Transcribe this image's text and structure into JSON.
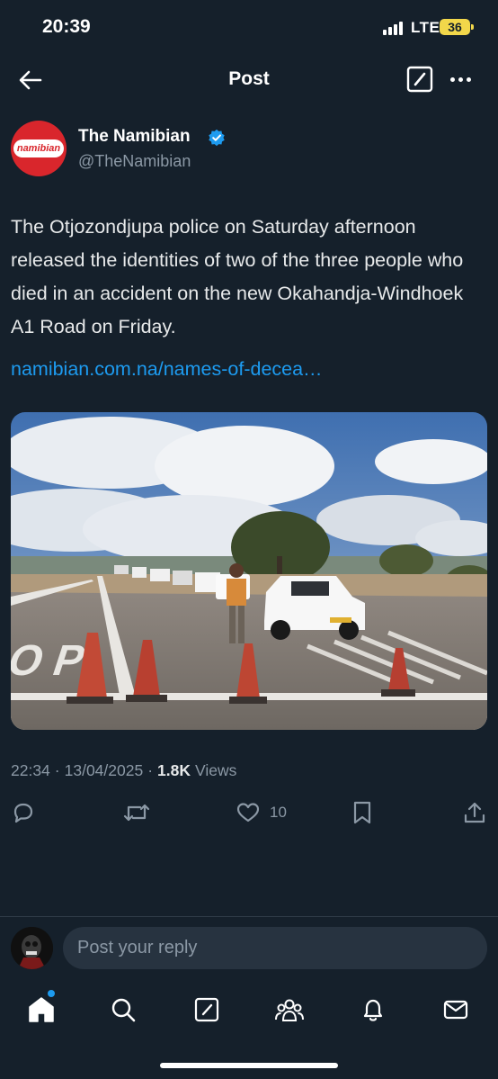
{
  "status_bar": {
    "time": "20:39",
    "network": "LTE",
    "battery": "36"
  },
  "header": {
    "title": "Post"
  },
  "author": {
    "name": "The Namibian",
    "handle": "@TheNamibian",
    "avatar_text": "namibian",
    "verified": true
  },
  "post": {
    "text": "The Otjozondjupa police on Saturday afternoon released the identities of two of the three people who died in an accident on the new Okahandja-Windhoek A1 Road on Friday.",
    "link": "namibian.com.na/names-of-decea…",
    "time": "22:34",
    "date": "13/04/2025",
    "views_count": "1.8K",
    "views_label": "Views"
  },
  "actions": {
    "likes": "10"
  },
  "reply": {
    "placeholder": "Post your reply"
  },
  "icons": {
    "back": "back-arrow-icon",
    "grok": "grok-icon",
    "more": "more-icon",
    "verified": "verified-badge-icon",
    "reply": "reply-icon",
    "repost": "repost-icon",
    "like": "heart-icon",
    "bookmark": "bookmark-icon",
    "share": "share-icon",
    "home": "home-icon",
    "search": "search-icon",
    "grok_tab": "grok-icon",
    "communities": "communities-icon",
    "notifications": "bell-icon",
    "messages": "mail-icon"
  },
  "colors": {
    "background": "#15202b",
    "accent": "#1d9bf0",
    "muted": "#8b98a5",
    "brand": "#d9262c",
    "battery": "#f2d74a"
  }
}
